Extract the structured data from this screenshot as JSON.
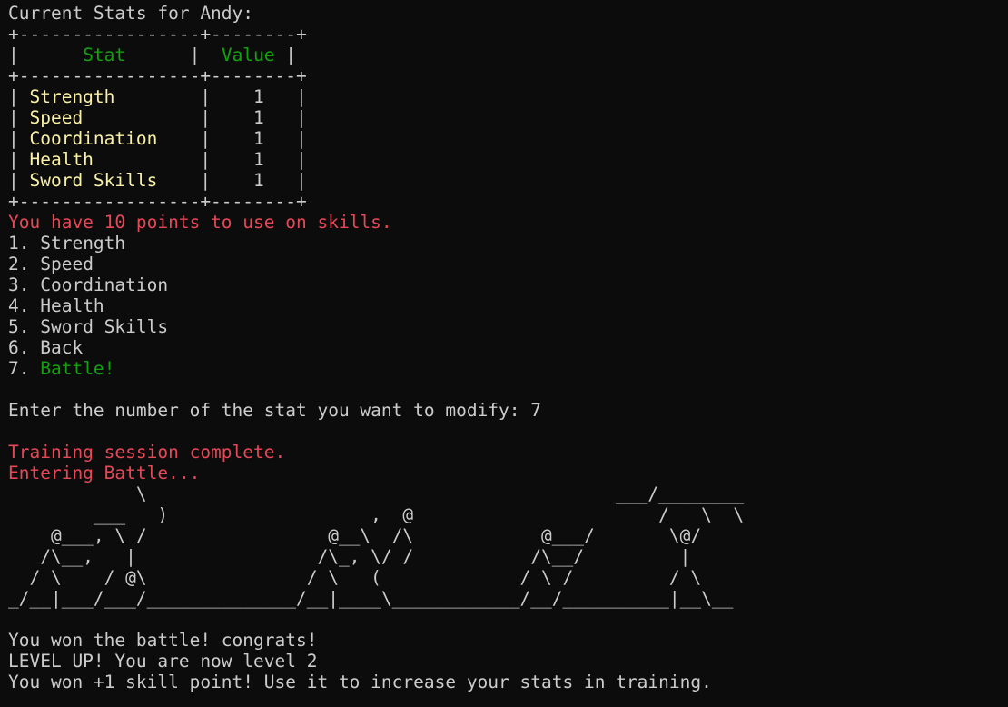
{
  "stats_header": "Current Stats for Andy:",
  "table": {
    "border": "+-----------------+--------+",
    "col_stat": "Stat",
    "col_value": "Value",
    "rows": [
      {
        "stat": "Strength",
        "value": "1"
      },
      {
        "stat": "Speed",
        "value": "1"
      },
      {
        "stat": "Coordination",
        "value": "1"
      },
      {
        "stat": "Health",
        "value": "1"
      },
      {
        "stat": "Sword Skills",
        "value": "1"
      }
    ]
  },
  "points_message": "You have 10 points to use on skills.",
  "menu": [
    {
      "num": "1. ",
      "label": "Strength"
    },
    {
      "num": "2. ",
      "label": "Speed"
    },
    {
      "num": "3. ",
      "label": "Coordination"
    },
    {
      "num": "4. ",
      "label": "Health"
    },
    {
      "num": "5. ",
      "label": "Sword Skills"
    },
    {
      "num": "6. ",
      "label": "Back"
    },
    {
      "num": "7. ",
      "label": "Battle!"
    }
  ],
  "prompt": "Enter the number of the stat you want to modify: ",
  "prompt_input": "7",
  "training_complete": "Training session complete.",
  "entering_battle": "Entering Battle...",
  "ascii_art": [
    "            \\                                            ___/________",
    "        ___   )                   ,  @                       /   \\  \\",
    "    @___, \\ /                 @__\\  /\\            @___/       \\@/",
    "   /\\__,   |                 /\\_, \\/ /           /\\__/         |",
    "  / \\    / @\\               / \\   (             / \\ /         / \\",
    "_/__|___/___/______________/__|____\\____________/__/__________|__\\__"
  ],
  "battle_result": "You won the battle! congrats!",
  "level_up": "LEVEL UP! You are now level 2",
  "skill_reward": "You won +1 skill point! Use it to increase your stats in training.",
  "colors": {
    "background": "#0c0c0c",
    "text": "#cccccc",
    "header_green": "#13a10e",
    "stat_yellow": "#f9f1a5",
    "alert_red": "#e74856"
  }
}
